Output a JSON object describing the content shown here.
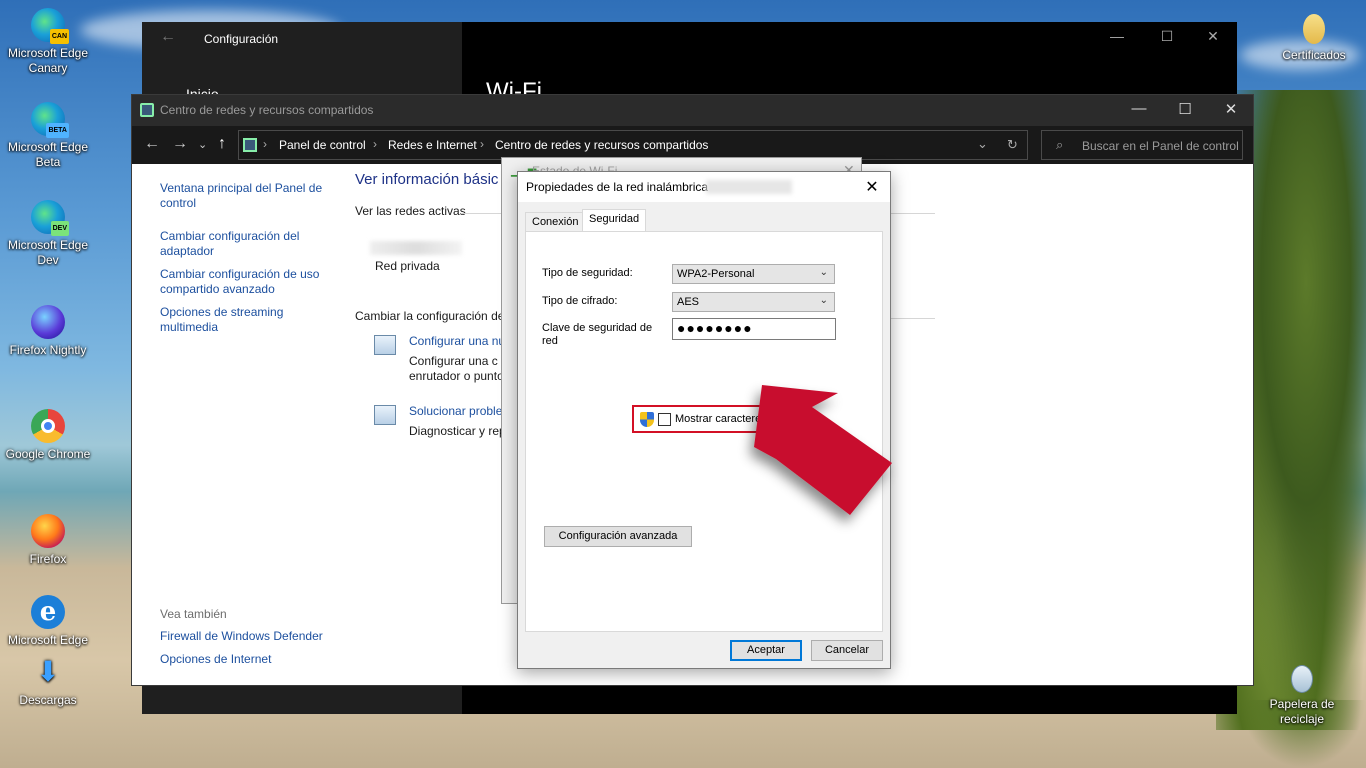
{
  "desktop": {
    "icons": [
      {
        "label": "Microsoft Edge Canary",
        "tag": "CAN"
      },
      {
        "label": "Microsoft Edge Beta",
        "tag": "BETA"
      },
      {
        "label": "Microsoft Edge Dev",
        "tag": "DEV"
      },
      {
        "label": "Firefox Nightly"
      },
      {
        "label": "Google Chrome"
      },
      {
        "label": "Firefox"
      },
      {
        "label": "Microsoft Edge"
      },
      {
        "label": "Descargas"
      },
      {
        "label": "Certificados"
      },
      {
        "label": "Papelera de reciclaje"
      }
    ]
  },
  "settings": {
    "title": "Configuración",
    "inicio": "Inicio",
    "page_heading": "Wi-Fi"
  },
  "control_panel": {
    "title": "Centro de redes y recursos compartidos",
    "breadcrumb": [
      "Panel de control",
      "Redes e Internet",
      "Centro de redes y recursos compartidos"
    ],
    "search_placeholder": "Buscar en el Panel de control",
    "sidebar": {
      "links": [
        "Ventana principal del Panel de control",
        "Cambiar configuración del adaptador",
        "Cambiar configuración de uso compartido avanzado",
        "Opciones de streaming multimedia"
      ],
      "see_also_heading": "Vea también",
      "see_also": [
        "Firewall de Windows Defender",
        "Opciones de Internet"
      ]
    },
    "main": {
      "heading": "Ver información básic",
      "active_networks": "Ver las redes activas",
      "network_type": "Red privada",
      "change_settings": "Cambiar la configuración de",
      "tasks": [
        {
          "title": "Configurar una nu",
          "desc_line1": "Configurar una c",
          "desc_line2": "enrutador o punto"
        },
        {
          "title": "Solucionar proble",
          "desc_line1": "Diagnosticar y rep"
        }
      ]
    }
  },
  "estado": {
    "title": "Estado de Wi-Fi"
  },
  "dialog": {
    "title": "Propiedades de la red inalámbrica",
    "tabs": [
      "Conexión",
      "Seguridad"
    ],
    "active_tab": "Seguridad",
    "fields": {
      "security_type_label": "Tipo de seguridad:",
      "security_type_value": "WPA2-Personal",
      "encryption_label": "Tipo de cifrado:",
      "encryption_value": "AES",
      "key_label": "Clave de seguridad de red",
      "key_value": "●●●●●●●●"
    },
    "show_chars_label": "Mostrar caracteres",
    "show_chars_checked": false,
    "advanced_button": "Configuración avanzada",
    "ok_button": "Aceptar",
    "cancel_button": "Cancelar"
  },
  "colors": {
    "highlight_box": "#d31025",
    "arrow": "#c8102e",
    "link": "#1c4f9e",
    "primary_button_border": "#0078d7"
  }
}
